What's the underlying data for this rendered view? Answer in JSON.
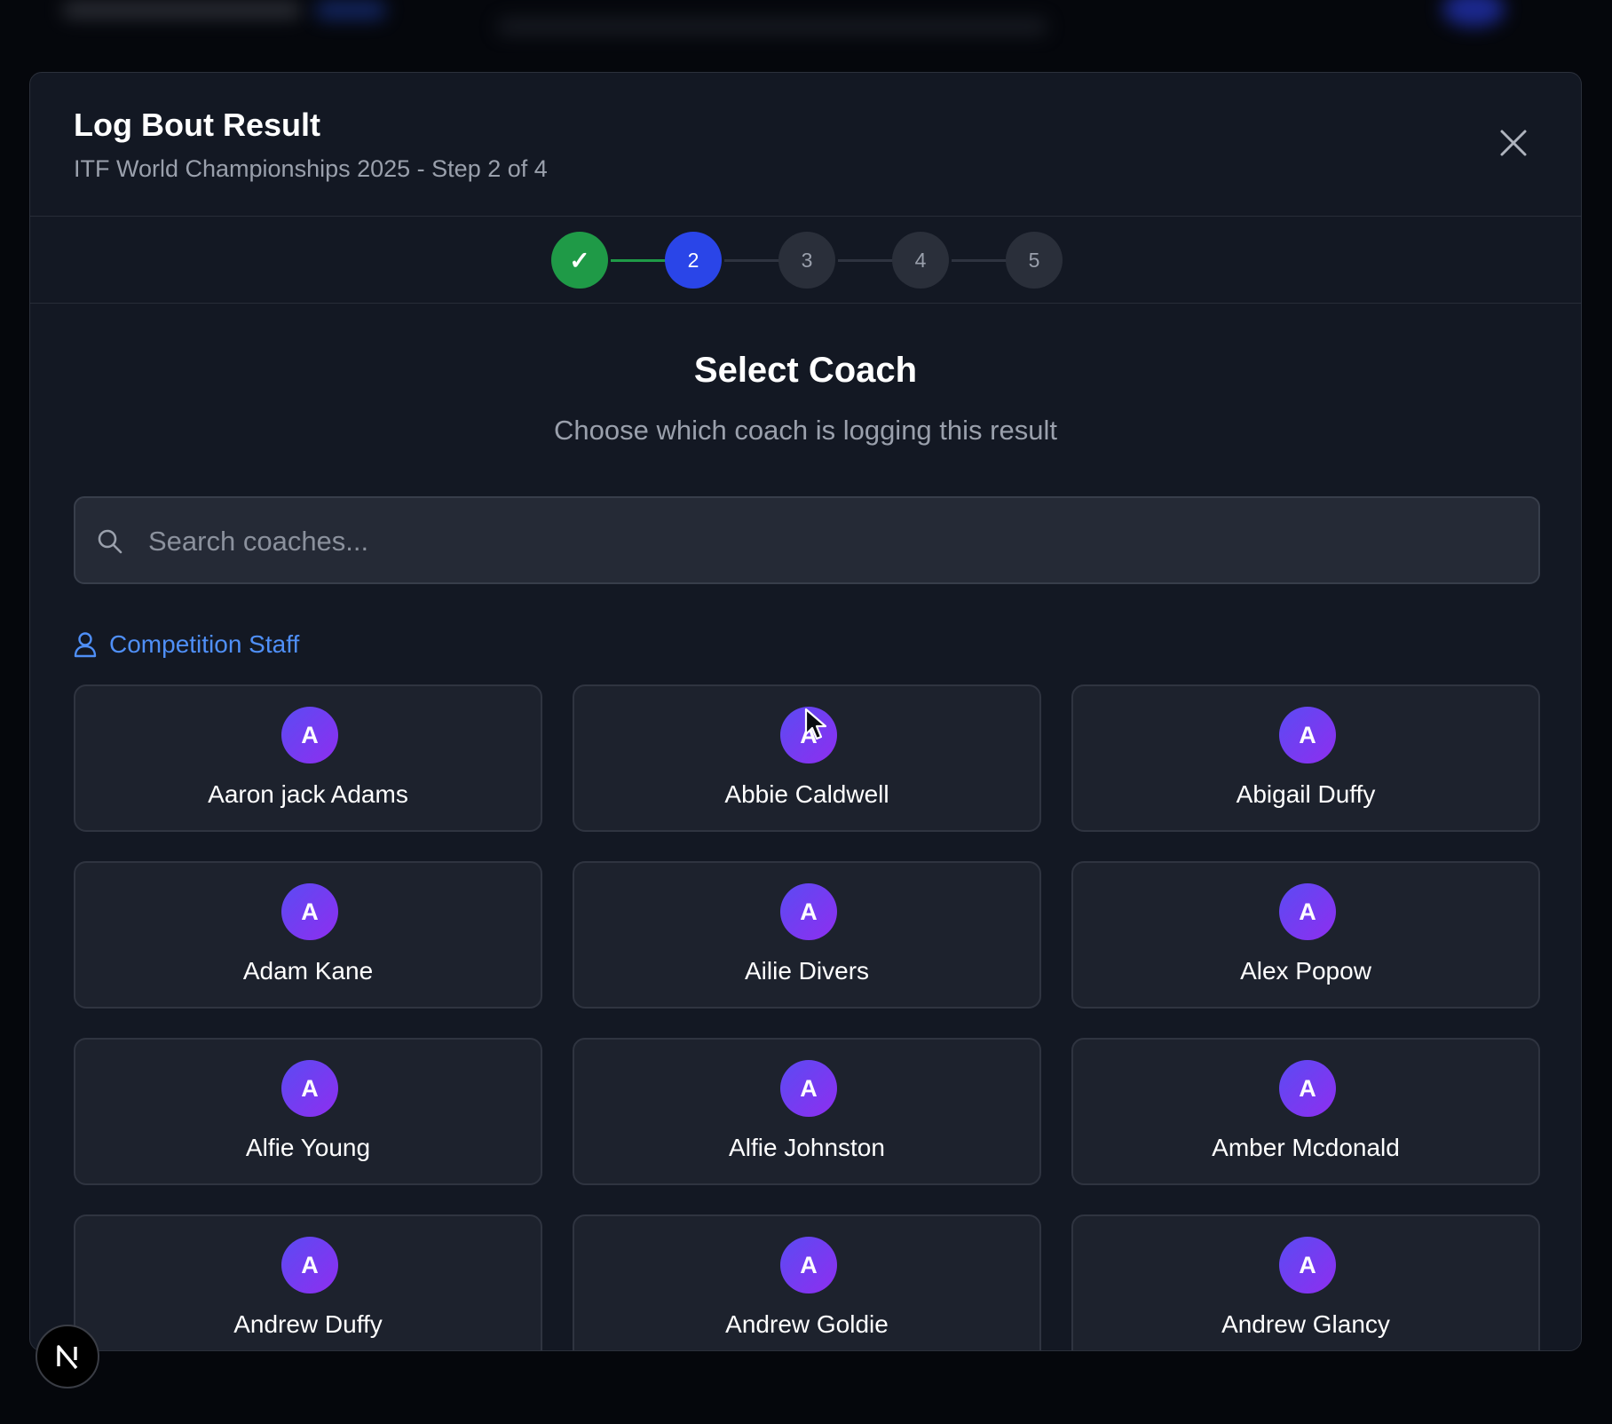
{
  "modal": {
    "title": "Log Bout Result",
    "subtitle": "ITF World Championships 2025 - Step 2 of 4",
    "close_icon": "close-icon"
  },
  "stepper": {
    "steps": [
      {
        "label": "✓",
        "state": "completed"
      },
      {
        "label": "2",
        "state": "active"
      },
      {
        "label": "3",
        "state": "upcoming"
      },
      {
        "label": "4",
        "state": "upcoming"
      },
      {
        "label": "5",
        "state": "upcoming"
      }
    ],
    "colors": {
      "completed": "#1f9a47",
      "active": "#2a45e8",
      "upcoming": "#2a2f3a"
    }
  },
  "section": {
    "title": "Select Coach",
    "subtitle": "Choose which coach is logging this result"
  },
  "search": {
    "placeholder": "Search coaches...",
    "value": "",
    "icon": "search-icon"
  },
  "group": {
    "label": "Competition Staff",
    "icon": "user-icon",
    "color": "#4f8ff7"
  },
  "coaches": [
    {
      "initial": "A",
      "name": "Aaron jack Adams"
    },
    {
      "initial": "A",
      "name": "Abbie Caldwell"
    },
    {
      "initial": "A",
      "name": "Abigail Duffy"
    },
    {
      "initial": "A",
      "name": "Adam Kane"
    },
    {
      "initial": "A",
      "name": "Ailie Divers"
    },
    {
      "initial": "A",
      "name": "Alex Popow"
    },
    {
      "initial": "A",
      "name": "Alfie Young"
    },
    {
      "initial": "A",
      "name": "Alfie Johnston"
    },
    {
      "initial": "A",
      "name": "Amber Mcdonald"
    },
    {
      "initial": "A",
      "name": "Andrew Duffy"
    },
    {
      "initial": "A",
      "name": "Andrew Goldie"
    },
    {
      "initial": "A",
      "name": "Andrew Glancy"
    }
  ],
  "badge": {
    "label": "N"
  }
}
